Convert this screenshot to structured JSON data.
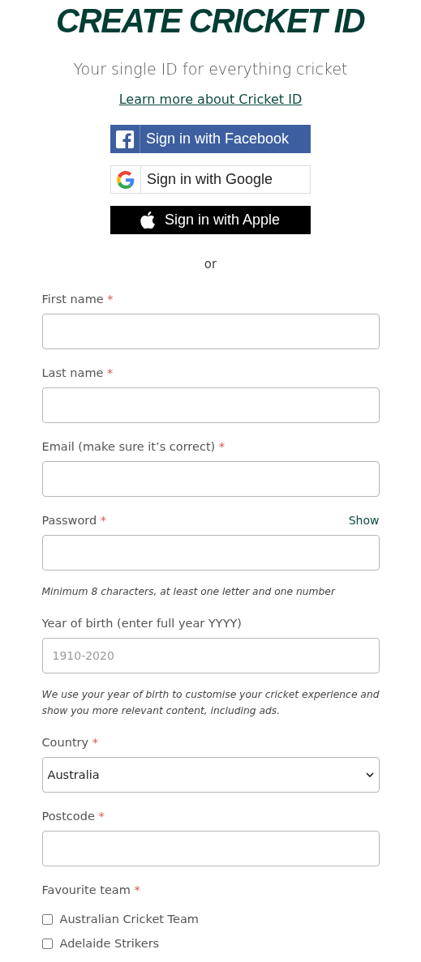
{
  "title": "CREATE CRICKET ID",
  "subtitle": "Your single ID for everything cricket",
  "learn_more_link": "Learn more about Cricket ID",
  "social_buttons": [
    {
      "kind": "facebook",
      "label": "Sign in with Facebook"
    },
    {
      "kind": "google",
      "label": "Sign in with Google"
    },
    {
      "kind": "apple",
      "label": "Sign in with Apple"
    }
  ],
  "separator": "or",
  "required_mark": "*",
  "fields": [
    {
      "kind": "text",
      "label": "First name",
      "required": true
    },
    {
      "kind": "text",
      "label": "Last name",
      "required": true
    },
    {
      "kind": "text",
      "label": "Email (make sure it’s correct)",
      "required": true
    },
    {
      "kind": "password",
      "label": "Password",
      "required": true,
      "toggle": "Show",
      "hint": "Minimum 8 characters, at least one letter and one number"
    },
    {
      "kind": "text",
      "label": "Year of birth (enter full year YYYY)",
      "required": false,
      "placeholder": "1910-2020",
      "hint": "We use your year of birth to customise your cricket experience and show you more relevant content, including ads."
    },
    {
      "kind": "select",
      "label": "Country",
      "required": true,
      "value": "Australia"
    },
    {
      "kind": "text",
      "label": "Postcode",
      "required": true
    }
  ],
  "favourite_team": {
    "label": "Favourite team",
    "required": true,
    "options": [
      {
        "label": "Australian Cricket Team",
        "checked": false
      },
      {
        "label": "Adelaide Strikers",
        "checked": false
      }
    ]
  }
}
